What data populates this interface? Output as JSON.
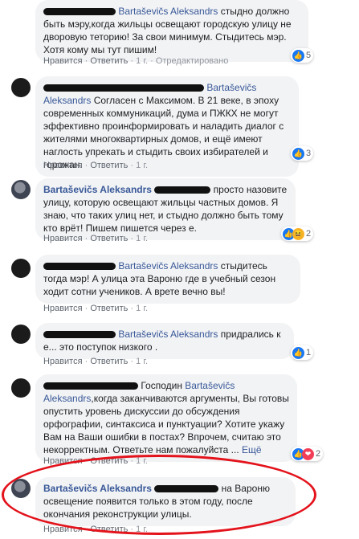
{
  "comments": [
    {
      "text": "стыдно должно быть мэру,когда жильцы освещают городскую улицу не дворовую теторию! За свои минимум. Стыдитесь мэр. Хотя кому мы тут пишим!",
      "tag": "Bartaševičs Aleksandrs",
      "like": "Нравится",
      "reply": "Ответить",
      "time": "1 г.",
      "extra": "Отредактировано",
      "reactions": "5"
    },
    {
      "tag": "Bartaševičs Aleksandrs",
      "text": "Согласен с Максимом. В 21 веке, в эпоху современных коммуникаций, дума и ПЖКХ не могут эффективно проинформировать и наладить диалог с жителями многоквартирных домов, и ещё имеют наглость упрекать и стыдить своих избирателей и горожан.",
      "like": "Нравится",
      "reply": "Ответить",
      "time": "1 г.",
      "reactions": "3"
    },
    {
      "name": "Bartaševičs Aleksandrs",
      "text_a": "просто назовите",
      "text_b": "улицу, которую освещают жильцы частных домов. Я знаю, что таких улиц нет, и стыдно должно быть тому кто врёт! Пишем пишется через е.",
      "like": "Нравится",
      "reply": "Ответить",
      "time": "1 г.",
      "reactions": "2"
    },
    {
      "tag": "Bartaševičs Aleksandrs",
      "text_a": "стыдитесь тогда",
      "text_b": "мэр! А улица эта Вароню где в учебный сезон ходит сотни учеников. А врете вечно вы!",
      "like": "Нравится",
      "reply": "Ответить",
      "time": "1 г."
    },
    {
      "tag": "Bartaševičs Aleksandrs",
      "text_a": "придрались к е... это",
      "text_b": "поступок низкого .",
      "like": "Нравится",
      "reply": "Ответить",
      "time": "1 г.",
      "reactions": "1"
    },
    {
      "prefix": "Господин",
      "tag": "Bartaševičs Aleksandrs",
      "text_a": ",когда",
      "text_b": "заканчиваются аргументы, Вы готовы опустить уровень дискуссии до обсуждения орфографии, синтаксиса и пунктуации? Хотите укажу Вам на Ваши ошибки в постах? Впрочем, считаю это некорректным. Ответьте нам пожалуйста ...",
      "more": "Ещё",
      "like": "Нравится",
      "reply": "Ответить",
      "time": "1 г.",
      "reactions": "2"
    },
    {
      "name": "Bartaševičs Aleksandrs",
      "text_a": "на Вароню",
      "text_b": "освещение появится только в этом году, после окончания реконструкции улицы.",
      "like": "Нравится",
      "reply": "Ответить",
      "time": "1 г."
    }
  ]
}
